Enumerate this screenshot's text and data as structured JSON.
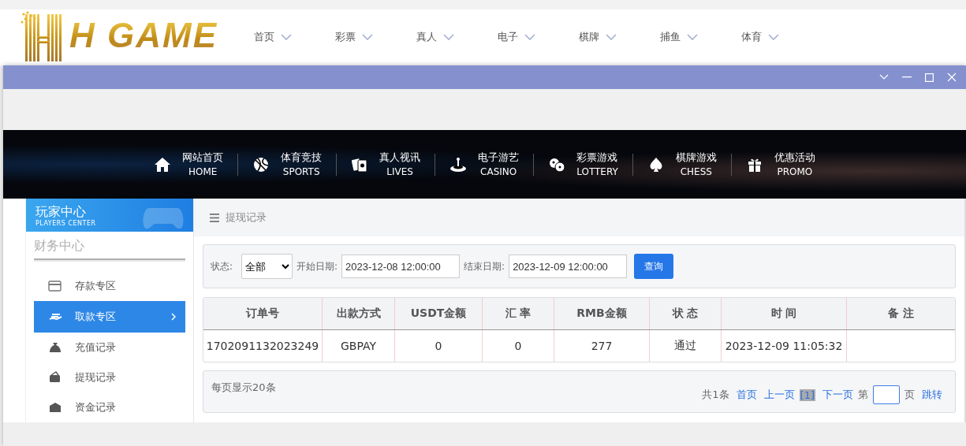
{
  "header": {
    "logo": "H GAME",
    "nav": [
      {
        "label": "首页"
      },
      {
        "label": "彩票"
      },
      {
        "label": "真人"
      },
      {
        "label": "电子"
      },
      {
        "label": "棋牌"
      },
      {
        "label": "捕鱼"
      },
      {
        "label": "体育"
      }
    ]
  },
  "categories": [
    {
      "title": "网站首页",
      "subtitle": "HOME"
    },
    {
      "title": "体育竞技",
      "subtitle": "SPORTS"
    },
    {
      "title": "真人视讯",
      "subtitle": "LIVES"
    },
    {
      "title": "电子游艺",
      "subtitle": "CASINO"
    },
    {
      "title": "彩票游戏",
      "subtitle": "LOTTERY"
    },
    {
      "title": "棋牌游戏",
      "subtitle": "CHESS"
    },
    {
      "title": "优惠活动",
      "subtitle": "PROMO"
    }
  ],
  "sidebar": {
    "title": "玩家中心",
    "subtitle": "PLAYERS CENTER",
    "section": "财务中心",
    "items": [
      {
        "label": "存款专区",
        "selected": false
      },
      {
        "label": "取款专区",
        "selected": true
      },
      {
        "label": "充值记录",
        "selected": false
      },
      {
        "label": "提现记录",
        "selected": false
      },
      {
        "label": "资金记录",
        "selected": false
      }
    ]
  },
  "breadcrumb": "提现记录",
  "filters": {
    "status_label": "状态:",
    "status_value": "全部",
    "start_label": "开始日期:",
    "start_value": "2023-12-08 12:00:00",
    "end_label": "结束日期:",
    "end_value": "2023-12-09 12:00:00",
    "button": "查询"
  },
  "table": {
    "columns": [
      "订单号",
      "出款方式",
      "USDT金额",
      "汇 率",
      "RMB金额",
      "状 态",
      "时 间",
      "备 注"
    ],
    "rows": [
      [
        "1702091132023249",
        "GBPAY",
        "0",
        "0",
        "277",
        "通过",
        "2023-12-09 11:05:32",
        ""
      ]
    ]
  },
  "pagination": {
    "per_page": "每页显示20条",
    "total": "共1条",
    "first": "首页",
    "prev": "上一页",
    "current": "[1]",
    "next": "下一页",
    "goto_prefix": "第",
    "goto_suffix": "页",
    "goto": "跳转"
  }
}
